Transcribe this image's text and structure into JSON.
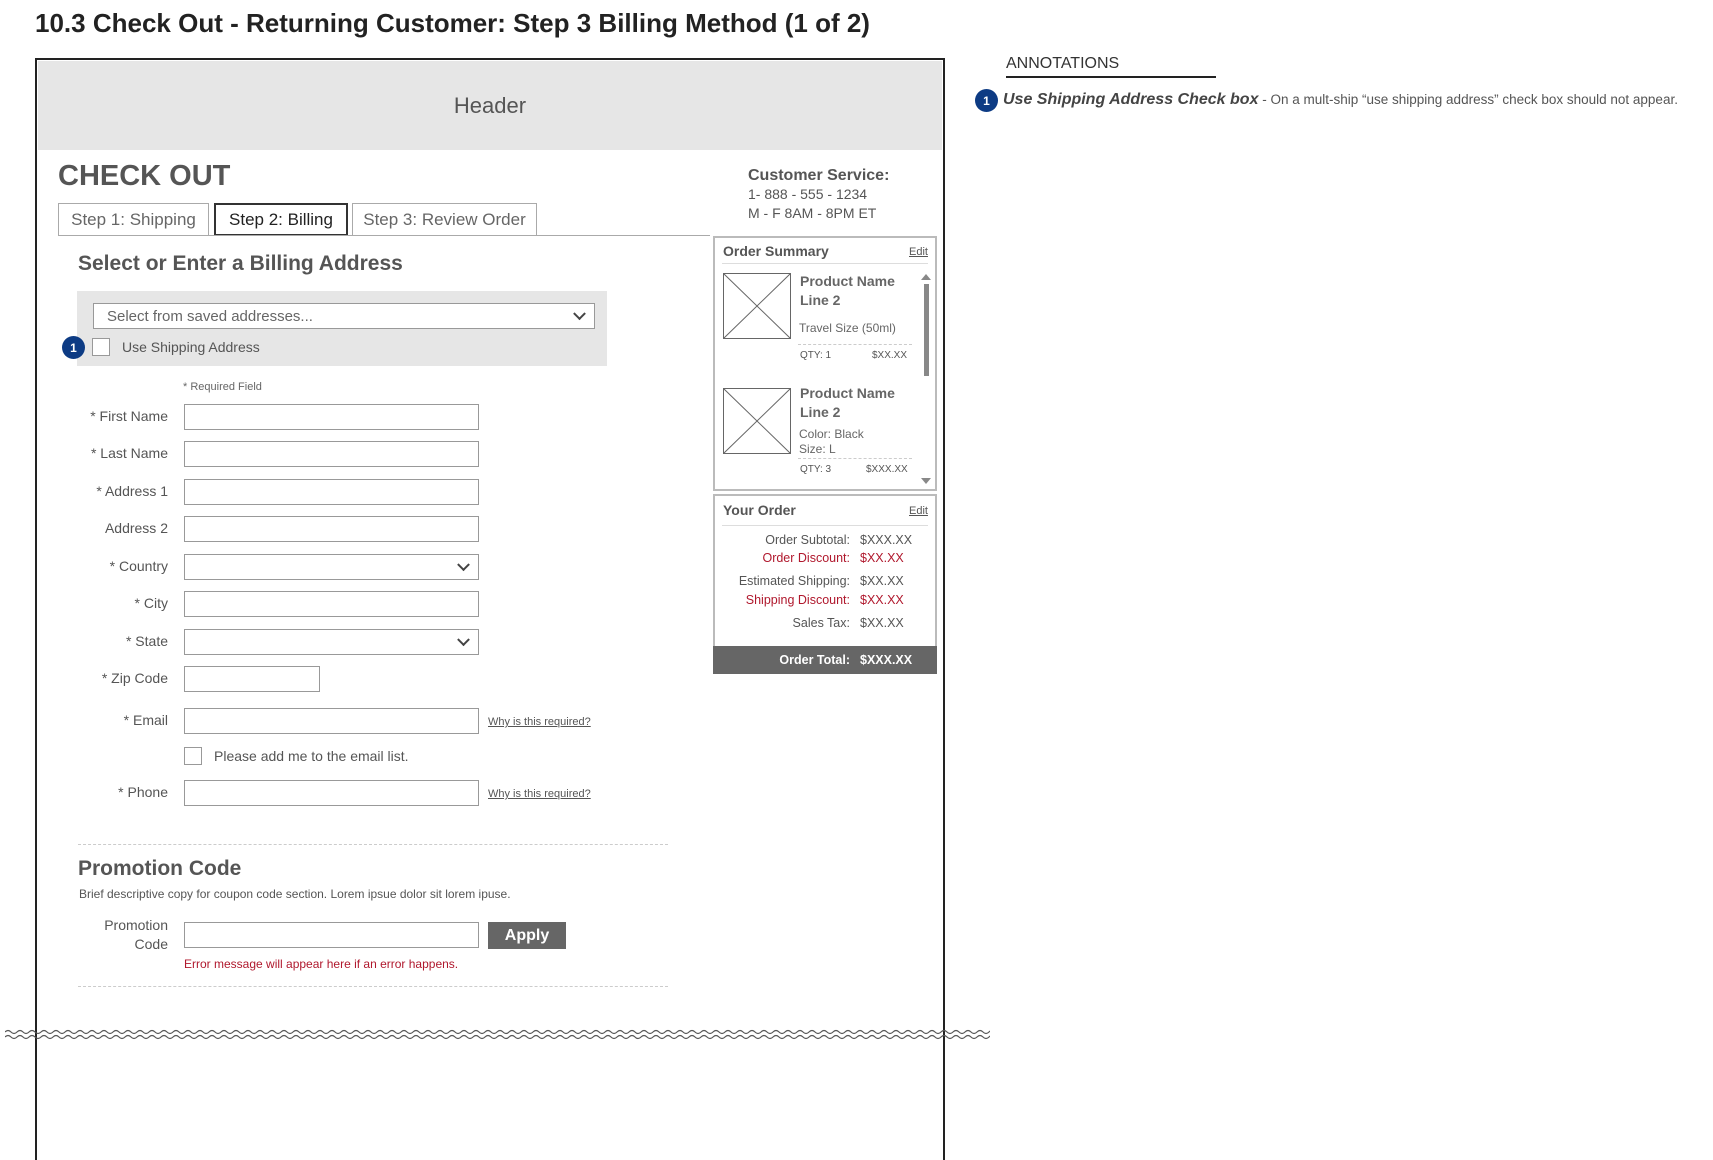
{
  "page_title": "10.3 Check Out - Returning Customer: Step 3 Billing Method (1 of 2)",
  "header": {
    "label": "Header"
  },
  "checkout": {
    "title": "CHECK OUT",
    "tabs": [
      {
        "label": "Step 1: Shipping",
        "active": false
      },
      {
        "label": "Step 2: Billing",
        "active": true
      },
      {
        "label": "Step 3: Review Order",
        "active": false
      }
    ]
  },
  "customer_service": {
    "title": "Customer Service:",
    "phone": "1- 888 - 555 - 1234",
    "hours": "M - F  8AM - 8PM ET"
  },
  "billing": {
    "heading": "Select or Enter a Billing Address",
    "saved_select": "Select from saved addresses...",
    "use_shipping_label": "Use Shipping Address",
    "annotation_marker": "1",
    "required_note": "* Required Field",
    "fields": {
      "first_name": "* First Name",
      "last_name": "* Last Name",
      "address1": "* Address 1",
      "address2": "Address 2",
      "country": "* Country",
      "city": "* City",
      "state": "* State",
      "zip": "* Zip Code",
      "email": "* Email",
      "phone": "* Phone"
    },
    "why_link": "Why is this required?",
    "email_list_label": "Please add me to the email list."
  },
  "promo": {
    "heading": "Promotion Code",
    "desc": "Brief descriptive copy for coupon code section. Lorem ipsue dolor sit lorem ipuse.",
    "label_line1": "Promotion",
    "label_line2": "Code",
    "apply": "Apply",
    "error": "Error message will appear here if an error happens."
  },
  "order_summary": {
    "title": "Order Summary",
    "edit": "Edit",
    "items": [
      {
        "name1": "Product Name",
        "name2": "Line 2",
        "detail1": "Travel Size (50ml)",
        "detail2": "",
        "qty": "QTY: 1",
        "price": "$XX.XX"
      },
      {
        "name1": "Product Name",
        "name2": "Line 2",
        "detail1": "Color: Black",
        "detail2": "Size: L",
        "qty": "QTY: 3",
        "price": "$XXX.XX"
      }
    ]
  },
  "your_order": {
    "title": "Your Order",
    "edit": "Edit",
    "rows": [
      {
        "label": "Order Subtotal:",
        "value": "$XXX.XX",
        "red": false
      },
      {
        "label": "Order Discount:",
        "value": "$XX.XX",
        "red": true
      },
      {
        "label": "Estimated Shipping:",
        "value": "$XX.XX",
        "red": false
      },
      {
        "label": "Shipping Discount:",
        "value": "$XX.XX",
        "red": true
      },
      {
        "label": "Sales Tax:",
        "value": "$XX.XX",
        "red": false
      }
    ],
    "total_label": "Order Total:",
    "total_value": "$XXX.XX"
  },
  "annotations": {
    "heading": "ANNOTATIONS",
    "items": [
      {
        "num": "1",
        "title": "Use Shipping Address Check box",
        "text": " - On a mult-ship “use shipping address” check box should not appear."
      }
    ]
  },
  "colors": {
    "accent": "#0d3b84",
    "error": "#b0182d",
    "panel_gray": "#e6e6e6",
    "button": "#666666"
  }
}
